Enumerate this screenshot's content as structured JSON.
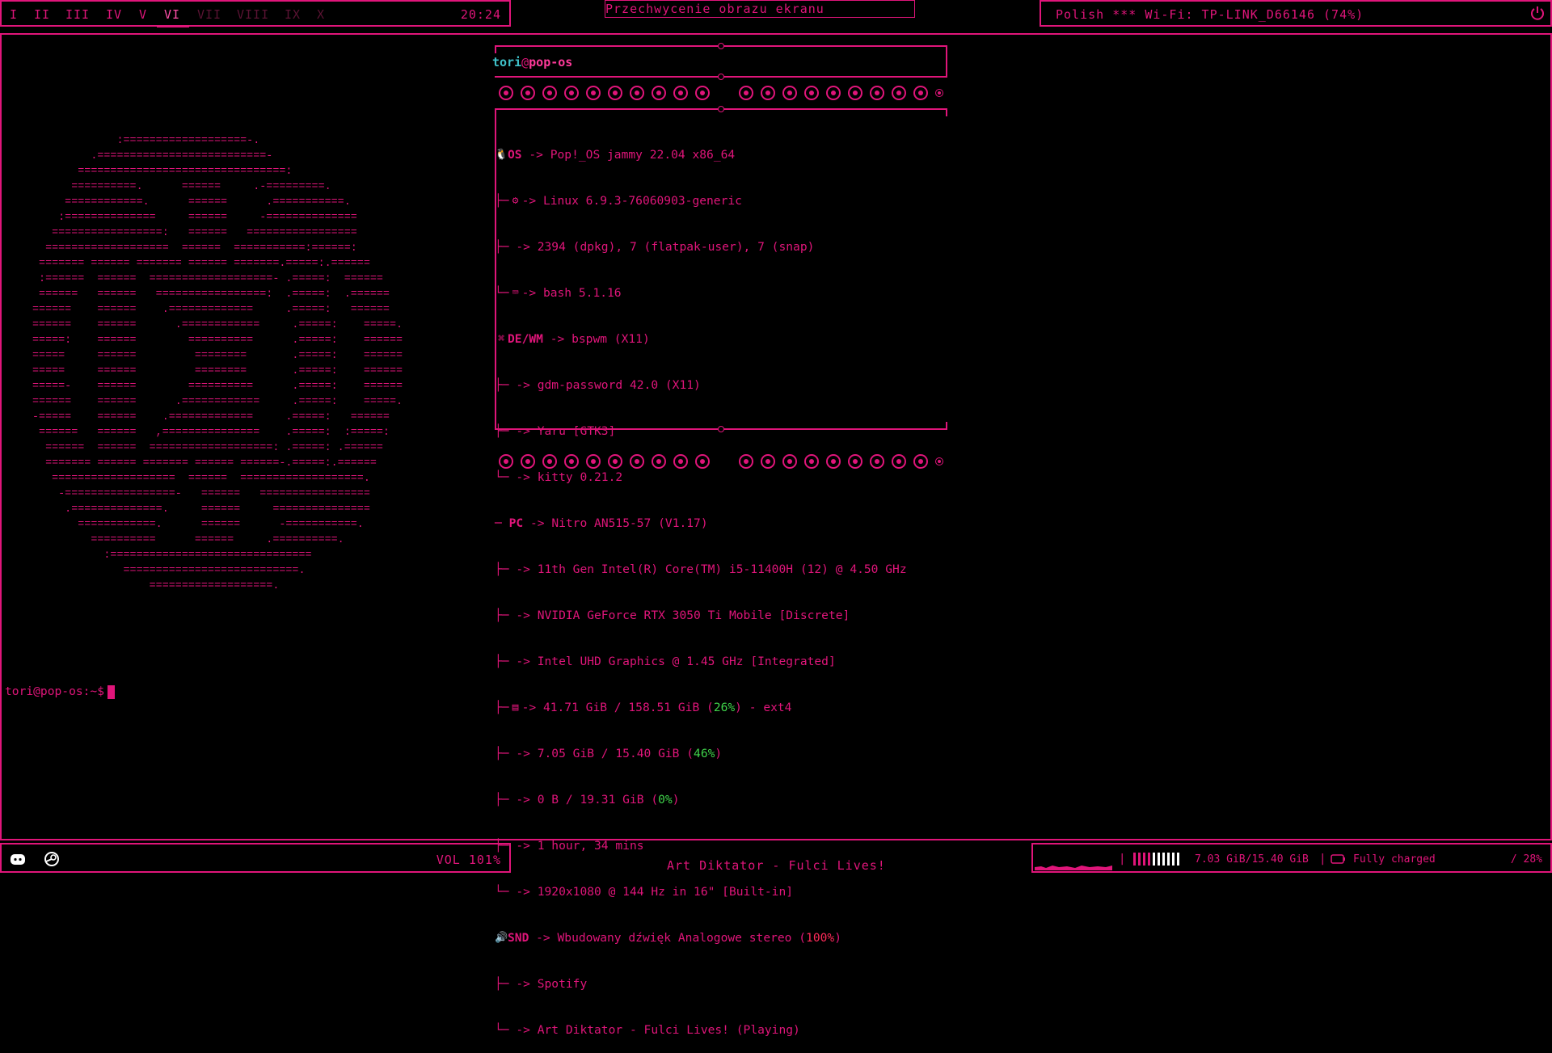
{
  "colors": {
    "accent": "#e0157a",
    "cyan": "#3fc1c9",
    "green": "#3fd24a",
    "red": "#ff2a5a",
    "dim": "#5a1333"
  },
  "topbar": {
    "workspaces": [
      {
        "label": "I",
        "state": "normal"
      },
      {
        "label": "II",
        "state": "normal"
      },
      {
        "label": "III",
        "state": "normal"
      },
      {
        "label": "IV",
        "state": "normal"
      },
      {
        "label": "V",
        "state": "normal"
      },
      {
        "label": "VI",
        "state": "active"
      },
      {
        "label": "VII",
        "state": "dim"
      },
      {
        "label": "VIII",
        "state": "dim"
      },
      {
        "label": "IX",
        "state": "dim"
      },
      {
        "label": "X",
        "state": "dim"
      }
    ],
    "clock": "20:24",
    "window_title": "Przechwycenie obrazu ekranu",
    "network": "Polish *** Wi-Fi: TP-LINK_D66146 (74%)",
    "power_icon": "power-icon"
  },
  "terminal": {
    "user": "tori",
    "at": "@",
    "host": "pop-os",
    "ascii_logo": "             :===================-.\n         .==========================-\n       ================================:\n      ==========.      ======     .-=========.\n     ============.      ======      .===========.\n    :==============     ======     -==============\n   =================:   ======   =================\n  ===================  ======  ===========:======:\n ======= ====== ======= ====== =======.=====:.======\n :======  ======  ===================- .=====:  ======\n ======   ======   =================:  .=====:  .======\n======    ======    .=============     .=====:   ======\n======    ======      .============     .=====:    =====.\n=====:    ======        ==========      .=====:    ======\n=====     ======         ========       .=====:    ======\n=====     ======         ========       .=====:    ======\n=====-    ======        ==========      .=====:    ======\n======    ======      .============     .=====:    =====.\n-=====    ======    .=============     .=====:   ======\n ======   ======   ,===============    .=====:  :=====:\n  ======  ======  ===================: .=====: .======\n  ======= ====== ======= ====== ======-.=====:.======\n   ===================  ======  ===================.\n    -=================-   ======   =================\n     .==============.     ======     ===============\n       ============.      ======      -===========.\n         ==========      ======     .==========.\n           :===============================\n              ===========================.\n                  ===================.",
    "info": [
      {
        "icon": "linux-icon",
        "key": "OS",
        "value": "Pop!_OS jammy 22.04 x86_64",
        "prefix": ""
      },
      {
        "icon": "gear-icon",
        "key": "",
        "value": "Linux 6.9.3-76060903-generic",
        "prefix": "├─"
      },
      {
        "icon": "",
        "key": "",
        "value": "2394 (dpkg), 7 (flatpak-user), 7 (snap)",
        "prefix": "├─"
      },
      {
        "icon": "shell-icon",
        "key": "",
        "value": "bash 5.1.16",
        "prefix": "└─"
      },
      {
        "icon": "desktop-icon",
        "key": "DE/WM",
        "value": "bspwm (X11)",
        "prefix": ""
      },
      {
        "icon": "",
        "key": "",
        "value": "gdm-password 42.0 (X11)",
        "prefix": "├─"
      },
      {
        "icon": "",
        "key": "",
        "value": "Yaru [GTK3]",
        "prefix": "├─"
      },
      {
        "icon": "",
        "key": "",
        "value": "kitty 0.21.2",
        "prefix": "└─"
      },
      {
        "icon": "",
        "key": "PC",
        "value": "Nitro AN515-57 (V1.17)",
        "prefix": "─"
      },
      {
        "icon": "",
        "key": "",
        "value": "11th Gen Intel(R) Core(TM) i5-11400H (12) @ 4.50 GHz",
        "prefix": "├─"
      },
      {
        "icon": "",
        "key": "",
        "value": "NVIDIA GeForce RTX 3050 Ti Mobile [Discrete]",
        "prefix": "├─"
      },
      {
        "icon": "",
        "key": "",
        "value": "Intel UHD Graphics @ 1.45 GHz [Integrated]",
        "prefix": "├─"
      },
      {
        "icon": "disk-icon",
        "key": "",
        "value": "41.71 GiB / 158.51 GiB (",
        "pct": "26%",
        "tail": ") - ext4",
        "prefix": "├─"
      },
      {
        "icon": "",
        "key": "",
        "value": "7.05 GiB / 15.40 GiB (",
        "pct": "46%",
        "tail": ")",
        "prefix": "├─"
      },
      {
        "icon": "",
        "key": "",
        "value": "0 B / 19.31 GiB (",
        "pct": "0%",
        "tail": ")",
        "prefix": "├─"
      },
      {
        "icon": "",
        "key": "",
        "value": "1 hour, 34 mins",
        "prefix": "├─"
      },
      {
        "icon": "",
        "key": "",
        "value": "1920x1080 @ 144 Hz in 16\" [Built-in]",
        "prefix": "└─"
      },
      {
        "icon": "speaker-icon",
        "key": "SND",
        "value": "Wbudowany dźwięk Analogowe stereo (",
        "pct": "100%",
        "tail": ")",
        "prefix": ""
      },
      {
        "icon": "",
        "key": "",
        "value": "Spotify",
        "prefix": "├─"
      },
      {
        "icon": "",
        "key": "",
        "value": "Art Diktator - Fulci Lives! (Playing)",
        "prefix": "└─"
      }
    ],
    "prompt": "tori@pop-os:~$"
  },
  "bottombar": {
    "apps": [
      "discord-icon",
      "steam-icon"
    ],
    "volume": "VOL 101%",
    "now_playing": "Art Diktator - Fulci Lives!",
    "separator": "|",
    "memory": "7.03 GiB/15.40 GiB",
    "battery": "Fully charged",
    "cpu": "/ 28%"
  }
}
